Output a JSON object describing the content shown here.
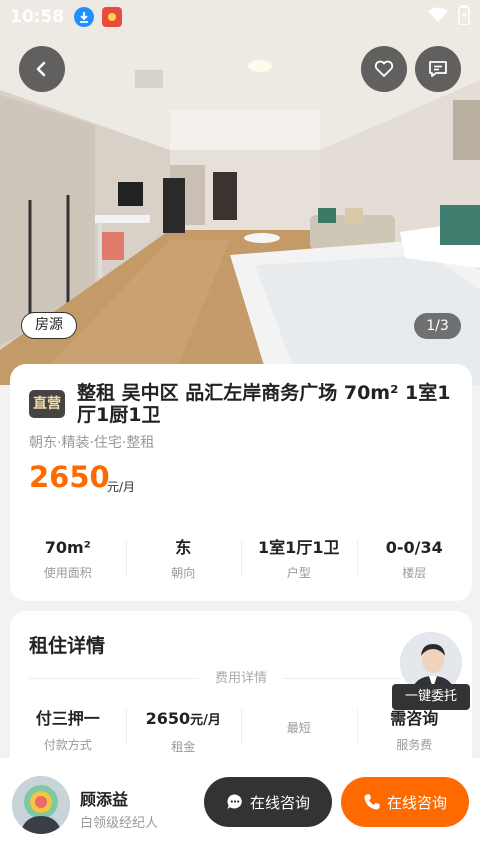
{
  "status_bar": {
    "time": "10:58"
  },
  "hero": {
    "tag": "房源",
    "counter": "1/3"
  },
  "listing": {
    "badge": "直营",
    "title": "整租 吴中区 品汇左岸商务广场 70m² 1室1厅1厨1卫",
    "tags": "朝东·精装·住宅·整租",
    "price": "2650",
    "price_unit": "元/月",
    "stats": [
      {
        "value": "70m²",
        "label": "使用面积"
      },
      {
        "value": "东",
        "label": "朝向"
      },
      {
        "value": "1室1厅1卫",
        "label": "户型"
      },
      {
        "value": "0-0/34",
        "label": "楼层"
      }
    ]
  },
  "rent_details": {
    "title": "租住详情",
    "fee_section": "费用详情",
    "items": [
      {
        "value": "付三押一",
        "label": "付款方式"
      },
      {
        "value": "2650",
        "unit": "元/月",
        "label": "租金"
      },
      {
        "value": "",
        "label": "最短"
      },
      {
        "value": "需咨询",
        "label": "服务费"
      }
    ]
  },
  "entrust": {
    "label": "一键委托"
  },
  "agent": {
    "name": "顾添益",
    "title": "白领级经纪人",
    "chat_button": "在线咨询",
    "call_button": "在线咨询"
  },
  "colors": {
    "accent": "#ff6a00",
    "dark": "#333333",
    "badge_text": "#f3d9a4"
  }
}
